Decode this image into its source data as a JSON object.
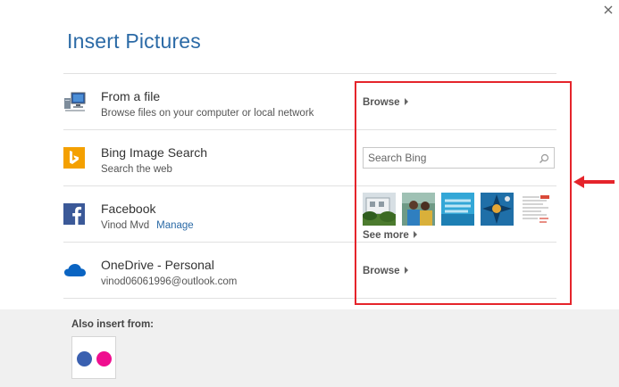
{
  "dialog": {
    "title": "Insert Pictures"
  },
  "sources": [
    {
      "name": "From a file",
      "subtitle": "Browse files on your computer or local network",
      "action": "Browse",
      "icon": "computer-icon"
    },
    {
      "name": "Bing Image Search",
      "subtitle": "Search the web",
      "search_placeholder": "Search Bing",
      "icon": "bing-icon"
    },
    {
      "name": "Facebook",
      "account": "Vinod Mvd",
      "manage_label": "Manage",
      "more_label": "See more",
      "icon": "facebook-icon"
    },
    {
      "name": "OneDrive - Personal",
      "subtitle": "vinod06061996@outlook.com",
      "action": "Browse",
      "icon": "onedrive-icon"
    }
  ],
  "footer": {
    "label": "Also insert from:",
    "service_icon": "flickr-icon"
  },
  "colors": {
    "accent": "#2b6aa6",
    "bing": "#f4a000",
    "facebook": "#3b5998",
    "onedrive": "#0a64c2",
    "highlight": "#e5242b",
    "flickr_blue": "#3a60b0",
    "flickr_pink": "#ef0e8f"
  }
}
